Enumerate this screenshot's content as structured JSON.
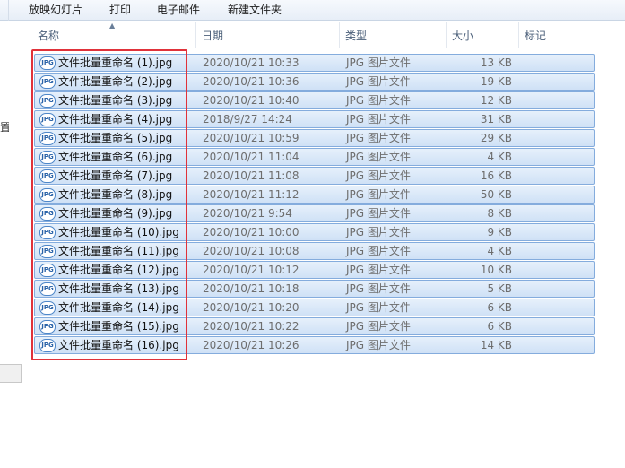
{
  "toolbar": {
    "items": [
      "放映幻灯片",
      "打印",
      "电子邮件",
      "新建文件夹"
    ]
  },
  "nav": {
    "partial_glyph": "置"
  },
  "columns": {
    "name": "名称",
    "date": "日期",
    "type": "类型",
    "size": "大小",
    "tags": "标记"
  },
  "icon_label": "JPG",
  "files": [
    {
      "name": "文件批量重命名 (1).jpg",
      "date": "2020/10/21 10:33",
      "type": "JPG 图片文件",
      "size": "13 KB"
    },
    {
      "name": "文件批量重命名 (2).jpg",
      "date": "2020/10/21 10:36",
      "type": "JPG 图片文件",
      "size": "19 KB"
    },
    {
      "name": "文件批量重命名 (3).jpg",
      "date": "2020/10/21 10:40",
      "type": "JPG 图片文件",
      "size": "12 KB"
    },
    {
      "name": "文件批量重命名 (4).jpg",
      "date": "2018/9/27 14:24",
      "type": "JPG 图片文件",
      "size": "31 KB"
    },
    {
      "name": "文件批量重命名 (5).jpg",
      "date": "2020/10/21 10:59",
      "type": "JPG 图片文件",
      "size": "29 KB"
    },
    {
      "name": "文件批量重命名 (6).jpg",
      "date": "2020/10/21 11:04",
      "type": "JPG 图片文件",
      "size": "4 KB"
    },
    {
      "name": "文件批量重命名 (7).jpg",
      "date": "2020/10/21 11:08",
      "type": "JPG 图片文件",
      "size": "16 KB"
    },
    {
      "name": "文件批量重命名 (8).jpg",
      "date": "2020/10/21 11:12",
      "type": "JPG 图片文件",
      "size": "50 KB"
    },
    {
      "name": "文件批量重命名 (9).jpg",
      "date": "2020/10/21 9:54",
      "type": "JPG 图片文件",
      "size": "8 KB"
    },
    {
      "name": "文件批量重命名 (10).jpg",
      "date": "2020/10/21 10:00",
      "type": "JPG 图片文件",
      "size": "9 KB"
    },
    {
      "name": "文件批量重命名 (11).jpg",
      "date": "2020/10/21 10:08",
      "type": "JPG 图片文件",
      "size": "4 KB"
    },
    {
      "name": "文件批量重命名 (12).jpg",
      "date": "2020/10/21 10:12",
      "type": "JPG 图片文件",
      "size": "10 KB"
    },
    {
      "name": "文件批量重命名 (13).jpg",
      "date": "2020/10/21 10:18",
      "type": "JPG 图片文件",
      "size": "5 KB"
    },
    {
      "name": "文件批量重命名 (14).jpg",
      "date": "2020/10/21 10:20",
      "type": "JPG 图片文件",
      "size": "6 KB"
    },
    {
      "name": "文件批量重命名 (15).jpg",
      "date": "2020/10/21 10:22",
      "type": "JPG 图片文件",
      "size": "6 KB"
    },
    {
      "name": "文件批量重命名 (16).jpg",
      "date": "2020/10/21 10:26",
      "type": "JPG 图片文件",
      "size": "14 KB"
    }
  ],
  "colors": {
    "selection_fill": "#cfe1f6",
    "selection_border": "#84acdd",
    "highlight_border": "#e0323a"
  }
}
